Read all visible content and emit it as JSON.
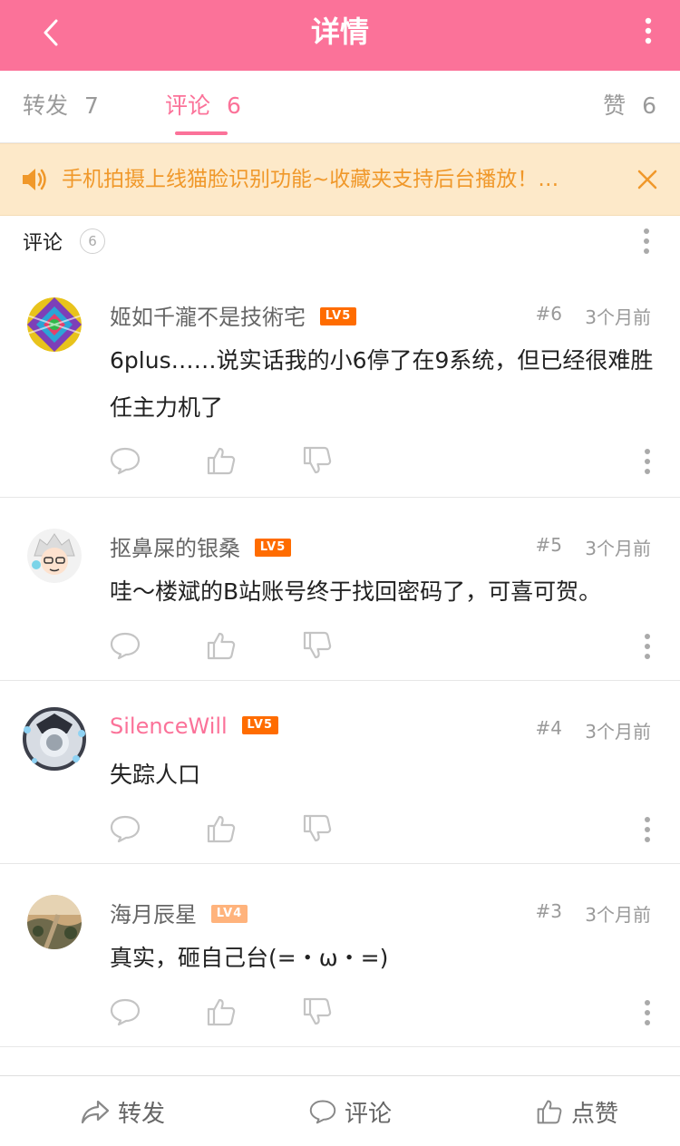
{
  "header": {
    "title": "详情",
    "back_icon": "chevron-left-icon",
    "more_icon": "more-vertical-icon"
  },
  "tabs": [
    {
      "label": "转发",
      "count": "7"
    },
    {
      "label": "评论",
      "count": "6",
      "active": true
    },
    {
      "label": "赞",
      "count": "6"
    }
  ],
  "notice": {
    "text": "手机拍摄上线猫脸识别功能~收藏夹支持后台播放！…",
    "icon": "speaker-icon",
    "close_icon": "close-icon"
  },
  "section": {
    "label": "评论",
    "count": "6"
  },
  "comments": [
    {
      "username": "姬如千瀧不是技術宅",
      "level": "LV5",
      "floor": "#6",
      "time": "3个月前",
      "text": "6plus……说实话我的小6停了在9系统，但已经很难胜任主力机了",
      "vip": false
    },
    {
      "username": "抠鼻屎的银桑",
      "level": "LV5",
      "floor": "#5",
      "time": "3个月前",
      "text": "哇～楼斌的B站账号终于找回密码了，可喜可贺。",
      "vip": false
    },
    {
      "username": "SilenceWill",
      "level": "LV5",
      "floor": "#4",
      "time": "3个月前",
      "text": "失踪人口",
      "vip": true
    },
    {
      "username": "海月辰星",
      "level": "LV4",
      "floor": "#3",
      "time": "3个月前",
      "text": "真实，砸自己台(=・ω・=)",
      "vip": false
    }
  ],
  "bottom_bar": {
    "repost": "转发",
    "comment": "评论",
    "like": "点赞"
  },
  "colors": {
    "brand_pink": "#fb7299",
    "notice_bg": "#fde9c9",
    "notice_text": "#f0982a",
    "level5": "#ff6c00",
    "level4": "#ffb37c"
  }
}
